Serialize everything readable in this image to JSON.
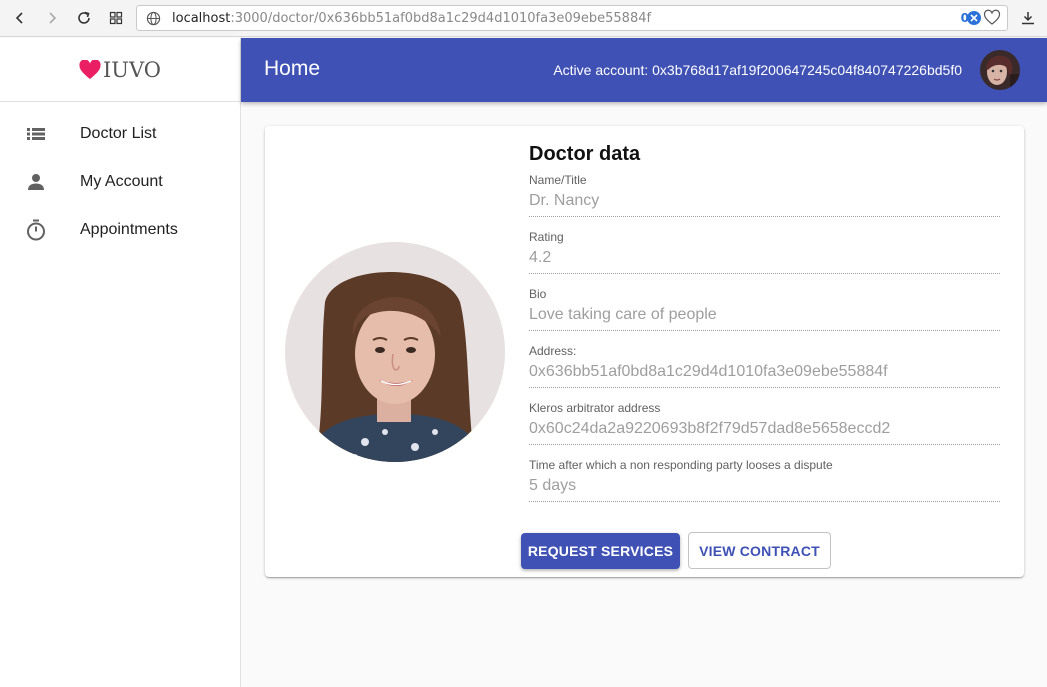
{
  "browser": {
    "url_host": "localhost",
    "url_path": ":3000/doctor/0x636bb51af0bd8a1c29d4d1010fa3e09ebe55884f",
    "blocked_count": "0"
  },
  "sidebar": {
    "logo_text": "IUVO",
    "items": [
      {
        "label": "Doctor List",
        "icon": "list-icon"
      },
      {
        "label": "My Account",
        "icon": "person-icon"
      },
      {
        "label": "Appointments",
        "icon": "timer-icon"
      }
    ]
  },
  "appbar": {
    "title": "Home",
    "active_account": "Active account: 0x3b768d17af19f200647245c04f840747226bd5f0"
  },
  "card": {
    "title": "Doctor data",
    "fields": [
      {
        "label": "Name/Title",
        "value": "Dr. Nancy"
      },
      {
        "label": "Rating",
        "value": "4.2"
      },
      {
        "label": "Bio",
        "value": "Love taking care of people"
      },
      {
        "label": "Address:",
        "value": "0x636bb51af0bd8a1c29d4d1010fa3e09ebe55884f"
      },
      {
        "label": "Kleros arbitrator address",
        "value": "0x60c24da2a9220693b8f2f79d57dad8e5658eccd2"
      },
      {
        "label": "Time after which a non responding party looses a dispute",
        "value": "5 days"
      }
    ],
    "request_button": "REQUEST SERVICES",
    "contract_button": "VIEW CONTRACT"
  },
  "colors": {
    "primary": "#3f51b5",
    "logo_heart": "#e91e63"
  }
}
